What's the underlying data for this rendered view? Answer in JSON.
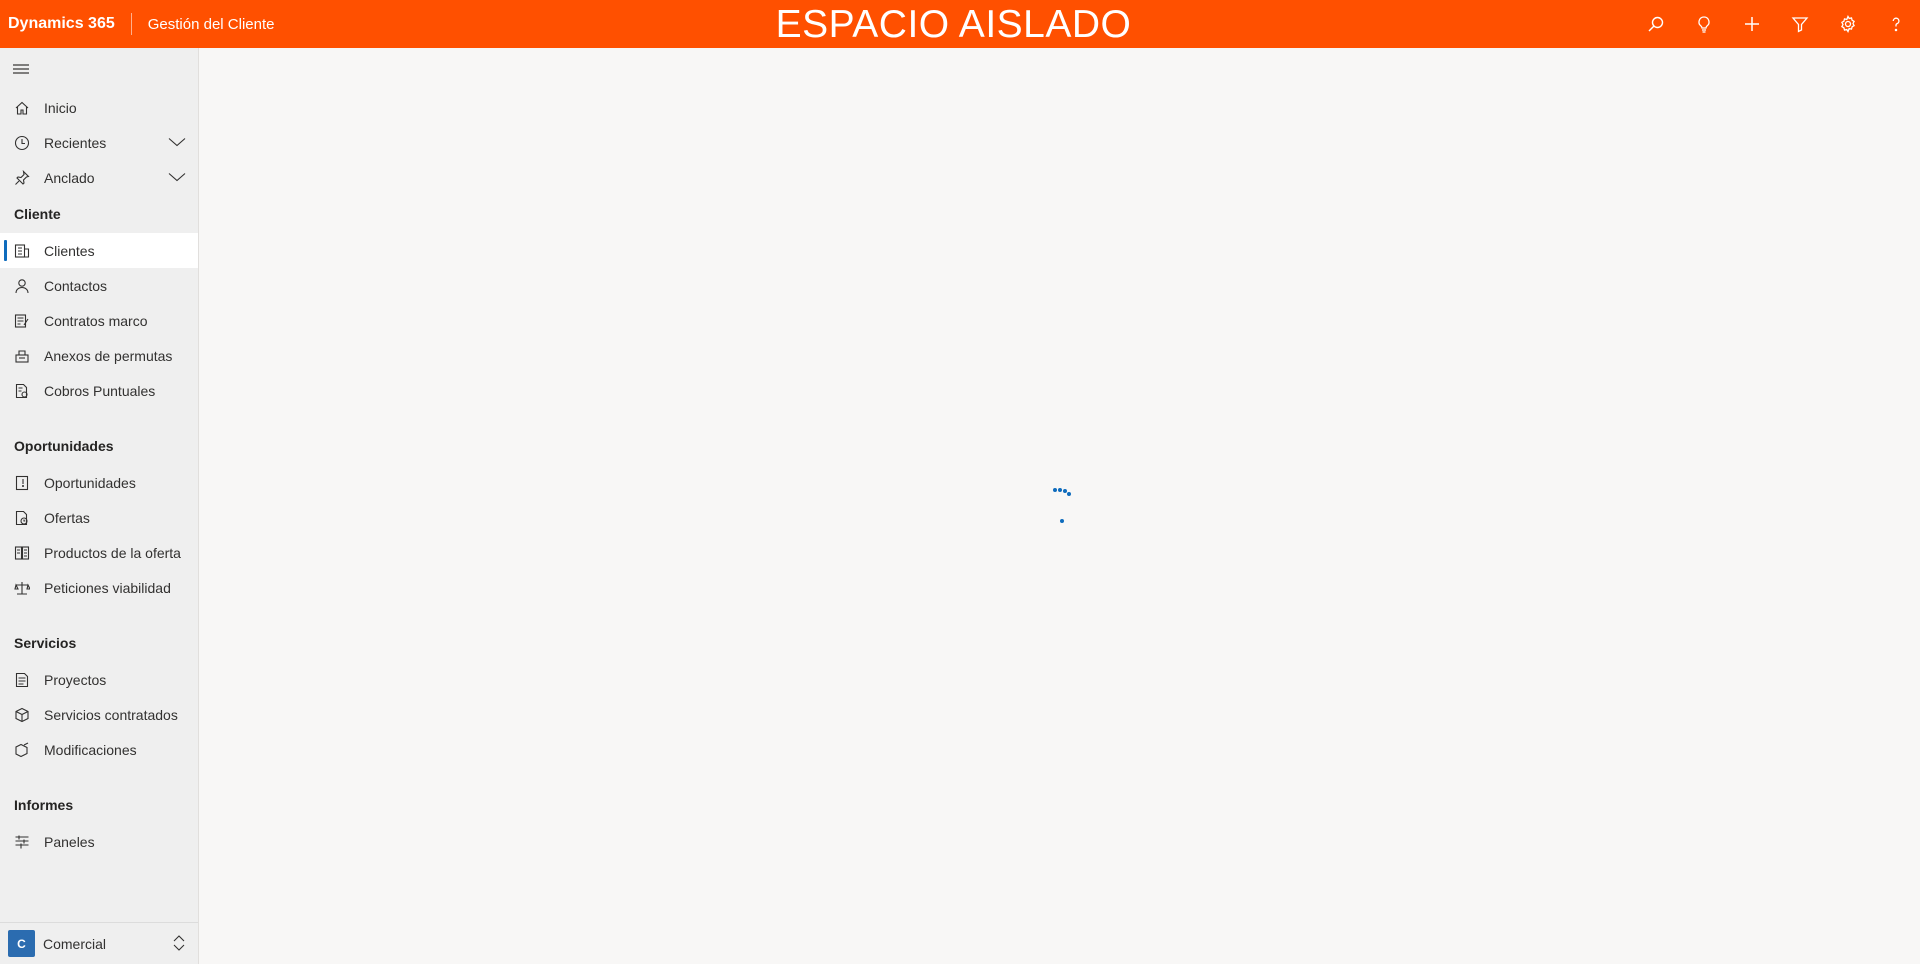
{
  "header": {
    "brand": "Dynamics 365",
    "app_name": "Gestión del Cliente",
    "environment_banner": "ESPACIO AISLADO",
    "background_color": "#ff5000",
    "actions": [
      "search-icon",
      "lightbulb-icon",
      "add-icon",
      "filter-icon",
      "settings-icon",
      "help-icon"
    ]
  },
  "sidebar": {
    "top_items": [
      {
        "label": "Inicio",
        "icon": "home-icon"
      },
      {
        "label": "Recientes",
        "icon": "clock-icon",
        "expandable": true
      },
      {
        "label": "Anclado",
        "icon": "pin-icon",
        "expandable": true
      }
    ],
    "groups": [
      {
        "title": "Cliente",
        "items": [
          {
            "label": "Clientes",
            "icon": "accounts-icon",
            "active": true
          },
          {
            "label": "Contactos",
            "icon": "contact-icon"
          },
          {
            "label": "Contratos marco",
            "icon": "contract-icon"
          },
          {
            "label": "Anexos de permutas",
            "icon": "annex-icon"
          },
          {
            "label": "Cobros Puntuales",
            "icon": "charge-icon"
          }
        ]
      },
      {
        "title": "Oportunidades",
        "items": [
          {
            "label": "Oportunidades",
            "icon": "opportunity-icon"
          },
          {
            "label": "Ofertas",
            "icon": "quote-icon"
          },
          {
            "label": "Productos de la oferta",
            "icon": "products-icon"
          },
          {
            "label": "Peticiones viabilidad",
            "icon": "feasibility-icon"
          }
        ]
      },
      {
        "title": "Servicios",
        "items": [
          {
            "label": "Proyectos",
            "icon": "project-icon"
          },
          {
            "label": "Servicios contratados",
            "icon": "services-icon"
          },
          {
            "label": "Modificaciones",
            "icon": "modifications-icon"
          }
        ]
      },
      {
        "title": "Informes",
        "items": [
          {
            "label": "Paneles",
            "icon": "dashboard-icon"
          }
        ]
      }
    ],
    "area": {
      "badge": "C",
      "label": "Comercial"
    }
  },
  "main": {
    "state": "loading-spinner",
    "accent_color": "#0f6cbd"
  }
}
